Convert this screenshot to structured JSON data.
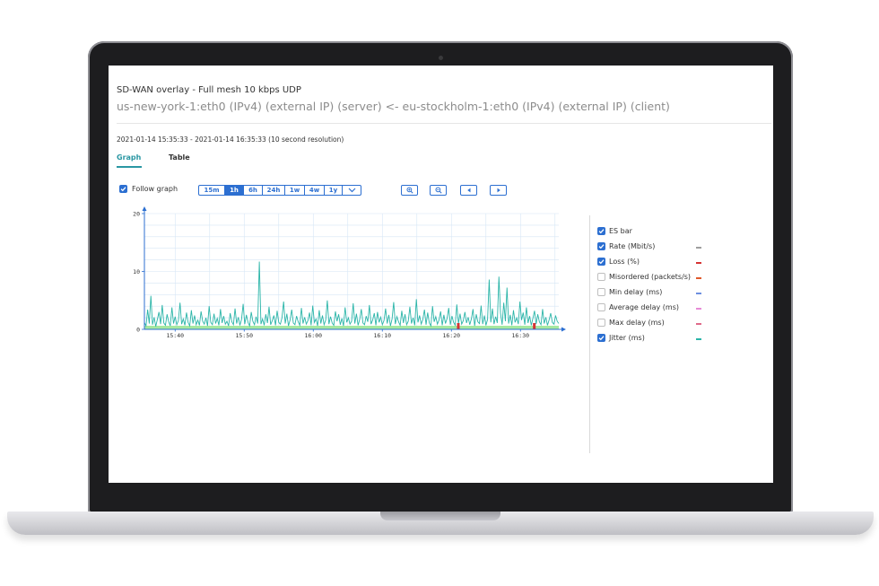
{
  "window": {
    "title": "SD-WAN overlay - Full mesh 10 kbps UDP",
    "subtitle": "us-new-york-1:eth0 (IPv4) (external IP) (server) <- eu-stockholm-1:eth0 (IPv4) (external IP) (client)",
    "time_range": "2021-01-14 15:35:33 - 2021-01-14 16:35:33 (10 second resolution)"
  },
  "tabs": [
    {
      "label": "Graph",
      "active": true
    },
    {
      "label": "Table",
      "active": false
    }
  ],
  "controls": {
    "follow_graph_label": "Follow graph",
    "follow_graph_checked": true,
    "ranges": [
      "15m",
      "1h",
      "6h",
      "24h",
      "1w",
      "4w",
      "1y"
    ],
    "active_range": "1h",
    "icons": [
      "chevron-down-icon",
      "zoom-in-icon",
      "zoom-out-icon",
      "arrow-left-icon",
      "arrow-right-icon"
    ]
  },
  "legend": [
    {
      "label": "ES bar",
      "checked": true,
      "color": ""
    },
    {
      "label": "Rate (Mbit/s)",
      "checked": true,
      "color": "#9e9e9e"
    },
    {
      "label": "Loss (%)",
      "checked": true,
      "color": "#d63333"
    },
    {
      "label": "Misordered (packets/s)",
      "checked": false,
      "color": "#e0592b"
    },
    {
      "label": "Min delay (ms)",
      "checked": false,
      "color": "#6d8fe0"
    },
    {
      "label": "Average delay (ms)",
      "checked": false,
      "color": "#e68ad6"
    },
    {
      "label": "Max delay (ms)",
      "checked": false,
      "color": "#e06a8a"
    },
    {
      "label": "Jitter (ms)",
      "checked": true,
      "color": "#2bb5a8"
    }
  ],
  "chart_data": {
    "type": "line",
    "x_ticks": [
      "15:40",
      "15:50",
      "16:00",
      "16:10",
      "16:20",
      "16:30"
    ],
    "y_ticks": [
      "0",
      "10",
      "20"
    ],
    "ylim": [
      0,
      20
    ],
    "grid": true,
    "es_bar_color": "#a6e8a0",
    "loss_marks_color": "#d63333",
    "loss_marks_x": [
      "16:21",
      "16:32"
    ],
    "series": [
      {
        "color": "#2bb5a8",
        "values": [
          1.2,
          0.6,
          3.4,
          1.0,
          5.8,
          0.8,
          2.1,
          0.5,
          1.7,
          3.0,
          0.9,
          4.2,
          1.1,
          0.7,
          2.6,
          1.3,
          0.6,
          3.8,
          1.0,
          2.2,
          0.8,
          1.5,
          4.6,
          0.9,
          1.8,
          0.7,
          2.9,
          1.2,
          0.6,
          3.3,
          1.0,
          2.4,
          0.8,
          1.6,
          0.7,
          3.1,
          1.4,
          0.9,
          2.0,
          0.6,
          4.0,
          1.2,
          0.8,
          2.7,
          1.0,
          1.9,
          0.7,
          3.5,
          1.1,
          2.3,
          0.9,
          1.4,
          0.6,
          2.8,
          1.3,
          0.8,
          3.6,
          1.0,
          2.1,
          0.7,
          1.7,
          4.4,
          0.9,
          2.5,
          1.2,
          0.6,
          3.0,
          1.4,
          0.8,
          2.2,
          1.0,
          11.7,
          0.9,
          1.8,
          0.7,
          2.6,
          1.1,
          3.9,
          0.8,
          1.5,
          2.4,
          0.7,
          3.2,
          1.2,
          0.9,
          2.0,
          4.8,
          1.0,
          2.7,
          0.6,
          1.6,
          3.4,
          1.1,
          0.8,
          2.3,
          1.3,
          0.7,
          3.7,
          1.0,
          2.1,
          0.9,
          1.5,
          2.9,
          0.7,
          4.1,
          1.2,
          1.8,
          0.6,
          3.3,
          1.0,
          2.4,
          0.8,
          1.6,
          5.0,
          0.9,
          2.2,
          1.1,
          0.7,
          3.1,
          1.4,
          2.6,
          0.8,
          1.9,
          0.6,
          3.8,
          1.2,
          2.0,
          0.9,
          1.4,
          4.5,
          1.0,
          2.7,
          0.7,
          1.7,
          3.5,
          1.1,
          0.8,
          2.3,
          1.3,
          4.2,
          0.9,
          1.6,
          2.8,
          0.7,
          3.0,
          1.2,
          2.1,
          0.8,
          1.5,
          3.6,
          1.0,
          2.5,
          0.6,
          1.8,
          4.7,
          0.9,
          2.2,
          1.3,
          0.7,
          3.2,
          1.1,
          2.6,
          0.8,
          1.4,
          3.9,
          1.0,
          2.0,
          0.7,
          5.2,
          1.2,
          2.4,
          0.9,
          1.7,
          3.4,
          0.8,
          2.9,
          1.1,
          0.6,
          4.0,
          1.3,
          2.2,
          0.9,
          1.6,
          3.1,
          0.7,
          2.5,
          1.0,
          1.9,
          3.7,
          0.8,
          2.3,
          1.2,
          0.7,
          4.3,
          1.0,
          2.7,
          0.9,
          1.5,
          3.0,
          1.1,
          2.1,
          0.8,
          1.8,
          3.5,
          0.6,
          2.6,
          1.3,
          1.0,
          4.1,
          0.9,
          2.4,
          0.7,
          1.7,
          8.6,
          1.2,
          3.6,
          0.9,
          2.2,
          1.1,
          9.1,
          2.8,
          0.8,
          4.6,
          1.4,
          7.2,
          1.0,
          2.5,
          0.7,
          3.3,
          1.2,
          2.0,
          0.9,
          4.8,
          1.6,
          2.9,
          0.8,
          3.8,
          1.1,
          2.3,
          0.7,
          1.9,
          3.2,
          0.9,
          2.6,
          1.3,
          0.8,
          3.5,
          1.0,
          2.1,
          0.7,
          1.6,
          2.8,
          1.2,
          0.9,
          2.4,
          1.4,
          1.0
        ]
      }
    ]
  }
}
